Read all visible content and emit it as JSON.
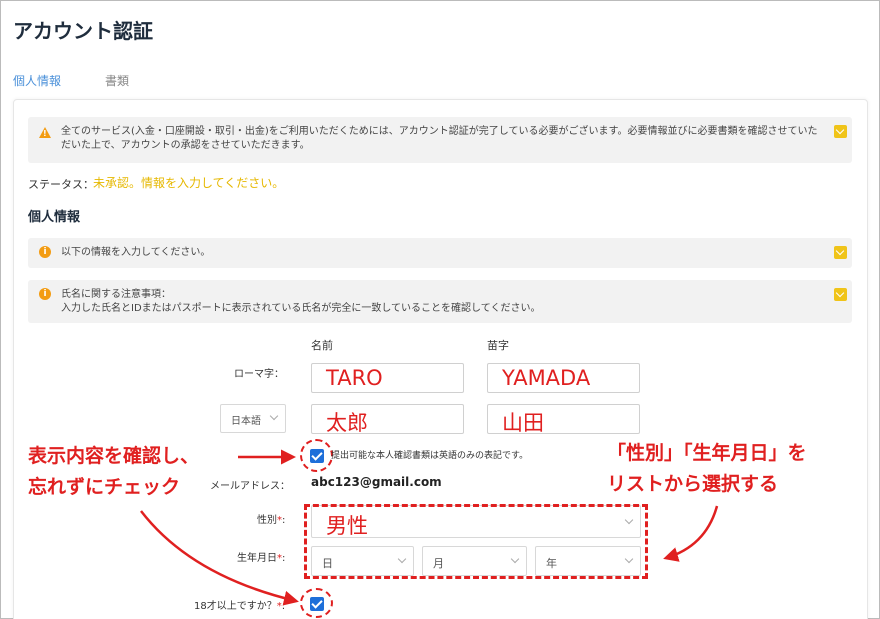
{
  "header": {
    "title": "アカウント認証"
  },
  "tabs": [
    {
      "label": "個人情報"
    },
    {
      "label": "書類"
    }
  ],
  "notices": {
    "n1": "全てのサービス(入金・口座開設・取引・出金)をご利用いただくためには、アカウント認証が完了している必要がございます。必要情報並びに必要書類を確認させていただいた上で、アカウントの承認をさせていただきます。",
    "n2": "以下の情報を入力してください。",
    "n3_line1": "氏名に関する注意事項：",
    "n3_line2": "入力した氏名とIDまたはパスポートに表示されている氏名が完全に一致していることを確認してください。"
  },
  "status": {
    "label": "ステータス：",
    "value": "未承認。情報を入力してください。"
  },
  "section": {
    "title": "個人情報"
  },
  "form": {
    "col_first": "名前",
    "col_last": "苗字",
    "romaji_label": "ローマ字：",
    "romaji_first": "TARO",
    "romaji_last": "YAMADA",
    "lang_select": "日本語",
    "kanji_first": "太郎",
    "kanji_last": "山田",
    "english_note": "提出可能な本人確認書類は英語のみの表記です。",
    "email_label": "メールアドレス：",
    "email_value": "abc123@gmail.com",
    "gender_label": "性別",
    "gender_value": "男性",
    "dob_label": "生年月日",
    "dob_day": "日",
    "dob_month": "月",
    "dob_year": "年",
    "age_label": "18才以上ですか？",
    "required_mark": "*",
    "colon": ":"
  },
  "annotations": {
    "left_line1": "表示内容を確認し、",
    "left_line2": "忘れずにチェック",
    "right_line1": "「性別」「生年月日」を",
    "right_line2": "リストから選択する"
  },
  "colors": {
    "accent": "#4a90d9",
    "warning": "#f39c12",
    "status": "#e6b800",
    "annotation": "#e02020",
    "checkbox": "#1e6fd9"
  }
}
